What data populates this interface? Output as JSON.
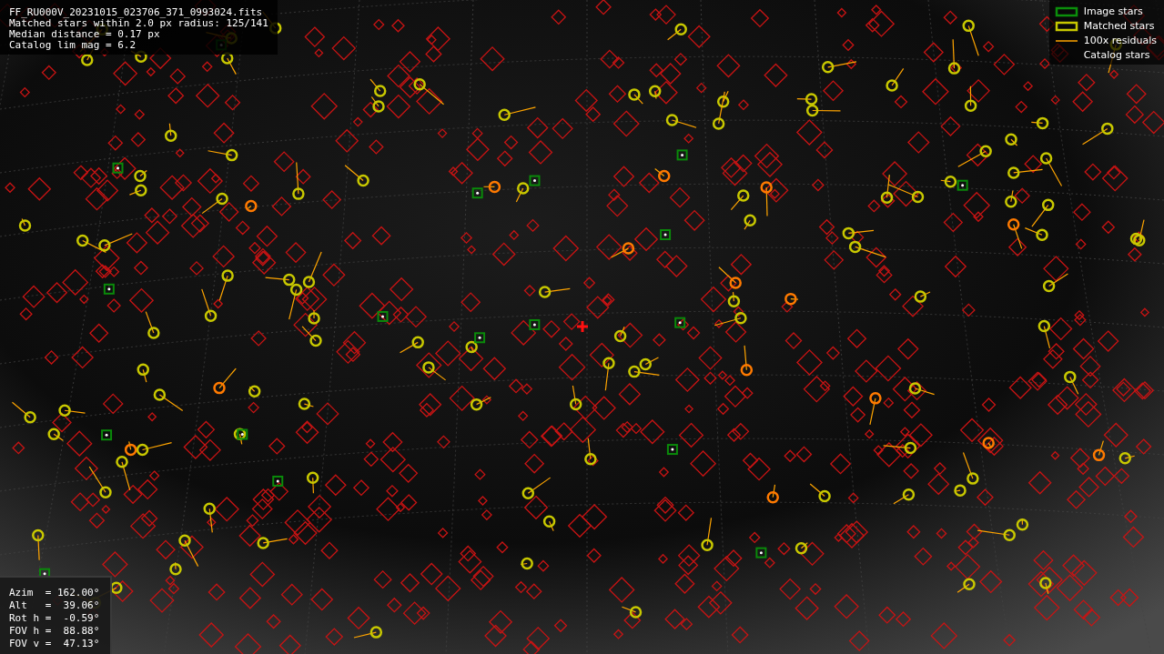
{
  "info_lines": [
    "FF_RU000V_20231015_023706_371_0993024.fits",
    "Matched stars within 2.0 px radius: 125/141",
    "Median distance = 0.17 px",
    "Catalog lim mag = 6.2"
  ],
  "legend": [
    {
      "kind": "image",
      "label": "Image stars"
    },
    {
      "kind": "matched",
      "label": "Matched stars"
    },
    {
      "kind": "residual",
      "label": "100x residuals"
    },
    {
      "kind": "catalog",
      "label": "Catalog stars"
    }
  ],
  "pointing": [
    "Azim  = 162.00°",
    "Alt   =  39.06°",
    "Rot h =  -0.59°",
    "FOV h =  88.88°",
    "FOV v =  47.13°"
  ]
}
